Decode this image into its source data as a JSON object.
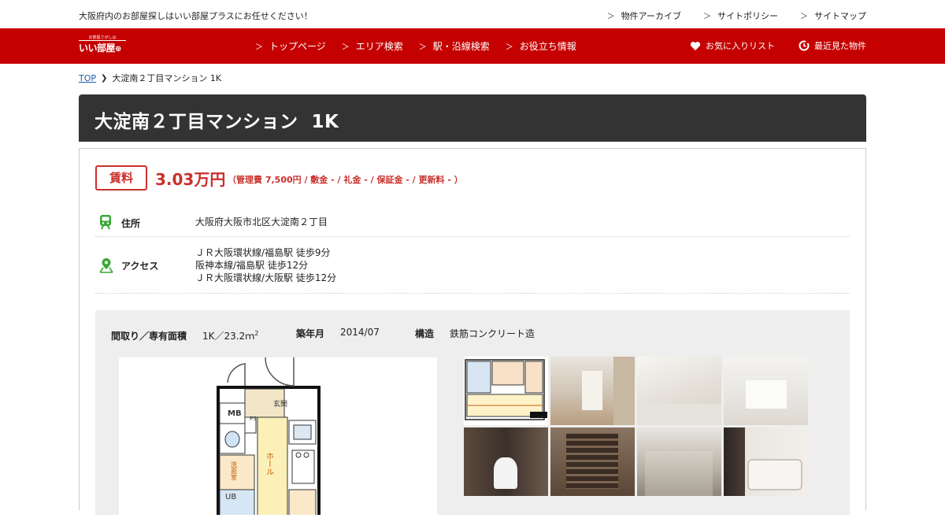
{
  "topbar": {
    "tagline": "大阪府内のお部屋探しはいい部屋プラスにお任せください！",
    "links": [
      "物件アーカイブ",
      "サイトポリシー",
      "サイトマップ"
    ]
  },
  "nav": {
    "logo_small": "お部屋さがしは",
    "logo_big": "いい部屋",
    "items": [
      "トップページ",
      "エリア検索",
      "駅・沿線検索",
      "お役立ち情報"
    ],
    "favorites": "お気に入りリスト",
    "recent": "最近見た物件"
  },
  "breadcrumb": {
    "top": "TOP",
    "current": "大淀南２丁目マンション 1K"
  },
  "title": "大淀南２丁目マンション  1K",
  "rent": {
    "label": "賃料",
    "price": "3.03万円",
    "details": "（管理費 7,500円 / 敷金 - / 礼金 - / 保証金 - / 更新料 - ）"
  },
  "address": {
    "label": "住所",
    "value": "大阪府大阪市北区大淀南２丁目"
  },
  "access": {
    "label": "アクセス",
    "lines": [
      "ＪＲ大阪環状線/福島駅 徒歩9分",
      "阪神本線/福島駅 徒歩12分",
      "ＪＲ大阪環状線/大阪駅 徒歩12分"
    ]
  },
  "spec": {
    "layout_label": "間取り／専有面積",
    "layout_value": "1K／23.2ｍ",
    "layout_sup": "2",
    "built_label": "築年月",
    "built_value": "2014/07",
    "structure_label": "構造",
    "structure_value": "鉄筋コンクリート造"
  },
  "floorplan_labels": {
    "mb": "MB",
    "ps": "PS",
    "entrance": "玄関",
    "hall": "ホール",
    "wash": "洗面室",
    "ub": "UB"
  },
  "icons": {
    "station": "train-icon",
    "map": "map-pin-icon",
    "heart": "heart-icon",
    "history": "history-icon"
  },
  "colors": {
    "brand_red": "#c50000",
    "price_red": "#c9302c",
    "title_bg": "#333333"
  }
}
